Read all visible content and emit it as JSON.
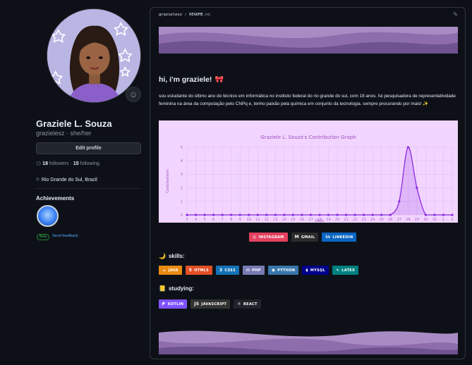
{
  "profile": {
    "name": "Graziele L. Souza",
    "login": "grazielesz · she/her",
    "edit_label": "Edit profile",
    "followers_count": "18",
    "followers_label": "followers",
    "separator": " · ",
    "following_count": "15",
    "following_label": "following",
    "location": "Rio Grande do Sul, Brazil",
    "achievements_title": "Achievements",
    "beta_label": "Beta",
    "feedback_label": "Send feedback"
  },
  "readme": {
    "path_user": "grazielesz",
    "path_sep": " / ",
    "path_file": "README",
    "path_ext": ".md",
    "greeting": "hi, i'm graziele!",
    "bio": "sou estudante do último ano do técnico em informática no instituto federal do rio grande do sul, com 18 anos. fui pesquisadora de representatividade feminina na área da computação pelo CNPq e, tenho paixão pela química em conjunto da tecnologia. sempre procurando por mais! ✨",
    "contact_badges": [
      {
        "label": "INSTAGRAM",
        "color": "#e4405f",
        "icon": "instagram-icon"
      },
      {
        "label": "GMAIL",
        "color": "#2b2b2b",
        "icon": "gmail-icon"
      },
      {
        "label": "LINKEDIN",
        "color": "#0a66c2",
        "icon": "linkedin-icon"
      }
    ],
    "skills_title": "skills:",
    "skills": [
      {
        "label": "JAVA",
        "color": "#e98b12"
      },
      {
        "label": "HTML5",
        "color": "#e34f26"
      },
      {
        "label": "CSS3",
        "color": "#1572b6"
      },
      {
        "label": "PHP",
        "color": "#777bb4"
      },
      {
        "label": "PYTHON",
        "color": "#3776ab"
      },
      {
        "label": "MYSQL",
        "color": "#00008b"
      },
      {
        "label": "LATEX",
        "color": "#008080"
      }
    ],
    "studying_title": "studying:",
    "studying": [
      {
        "label": "KOTLIN",
        "color": "#7f52ff"
      },
      {
        "label": "JAVASCRIPT",
        "color": "#323330"
      },
      {
        "label": "REACT",
        "color": "#20232a"
      }
    ]
  },
  "chart_data": {
    "type": "area",
    "title": "Graziele L. Souza's Contribution Graph",
    "xlabel": "Days",
    "ylabel": "Contributions",
    "x": [
      "3",
      "4",
      "5",
      "6",
      "7",
      "8",
      "9",
      "10",
      "11",
      "12",
      "13",
      "14",
      "15",
      "16",
      "17",
      "18",
      "19",
      "20",
      "21",
      "22",
      "23",
      "24",
      "25",
      "26",
      "27",
      "28",
      "29",
      "30",
      "31",
      "1",
      "2"
    ],
    "values": [
      0,
      0,
      0,
      0,
      0,
      0,
      0,
      0,
      0,
      0,
      0,
      0,
      0,
      0,
      0,
      0,
      0,
      0,
      0,
      0,
      0,
      0,
      0,
      0,
      1,
      5,
      2,
      0,
      0,
      0,
      0
    ],
    "ylim": [
      0,
      5
    ],
    "yticks": [
      "0",
      "1",
      "2",
      "3",
      "4",
      "5"
    ],
    "grid": true,
    "line_color": "#8a2be2",
    "background": "#f2d5ff"
  }
}
